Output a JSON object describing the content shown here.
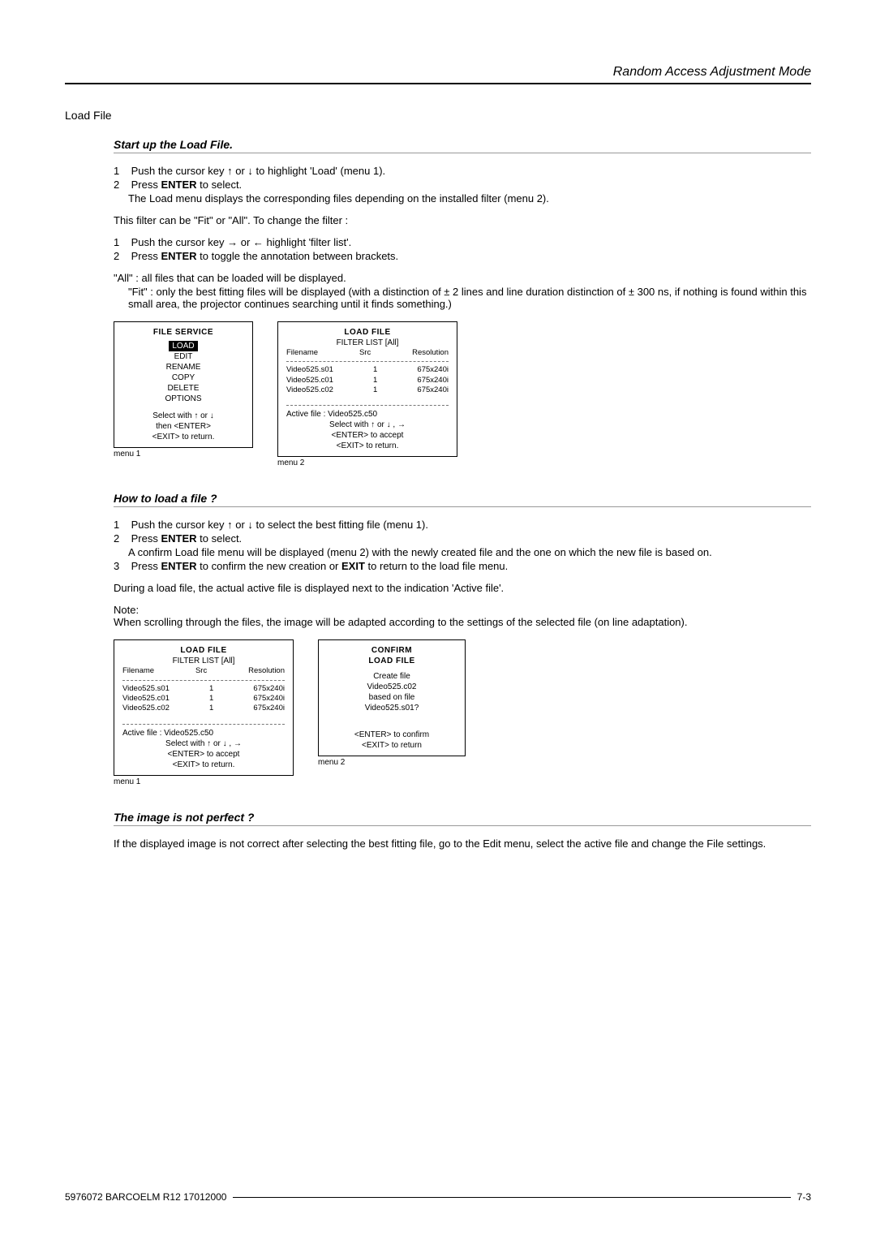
{
  "header": {
    "title": "Random Access Adjustment Mode"
  },
  "sectionTitle": "Load File",
  "s1": {
    "title": "Start up the Load File.",
    "step1a": "Push the cursor key ",
    "step1b": " or ",
    "step1c": " to highlight 'Load' (menu 1).",
    "step2a": "Press ",
    "step2b": "ENTER",
    "step2c": " to select.",
    "step2d": "The Load menu displays the corresponding files depending on the installed filter (menu 2).",
    "p1": "This filter can be \"Fit\" or \"All\".  To change the filter :",
    "f1a": "Push the cursor key ",
    "f1b": " or ",
    "f1c": " highlight 'filter list'.",
    "f2a": "Press ",
    "f2b": "ENTER",
    "f2c": " to toggle the annotation between brackets.",
    "all": "\"All\" : all files that can be loaded will be displayed.",
    "fit": "\"Fit\" : only the best fitting files will  be displayed (with a distinction of ± 2 lines and line duration distinction of ± 300 ns, if nothing is found within this small area, the projector continues searching until it finds something.)"
  },
  "fileServiceMenu": {
    "title": "FILE  SERVICE",
    "items": [
      "LOAD",
      "EDIT",
      "RENAME",
      "COPY",
      "DELETE",
      "OPTIONS"
    ],
    "hint1": "Select with ↑ or ↓",
    "hint2": "then  <ENTER>",
    "hint3": "<EXIT>  to  return.",
    "caption": "menu 1"
  },
  "loadFileMenu": {
    "title": "LOAD  FILE",
    "subtitle": "FILTER  LIST  [All]",
    "cols": [
      "Filename",
      "Src",
      "Resolution"
    ],
    "rows": [
      [
        "Video525.s01",
        "1",
        "675x240i"
      ],
      [
        "Video525.c01",
        "1",
        "675x240i"
      ],
      [
        "Video525.c02",
        "1",
        "675x240i"
      ]
    ],
    "active": "Active  file  :  Video525.c50",
    "hint1": "Select with ↑  or ↓ , →",
    "hint2": "<ENTER>  to  accept",
    "hint3": "<EXIT>  to  return.",
    "caption": "menu 2"
  },
  "s2": {
    "title": "How to load a file ?",
    "step1a": "Push the cursor key ",
    "step1b": " or ",
    "step1c": " to select the best fitting file (menu 1).",
    "step2a": "Press ",
    "step2b": "ENTER",
    "step2c": " to select.",
    "step2d": "A confirm Load file menu will be displayed (menu 2) with the newly created file and the one on which the new file is based on.",
    "step3a": "Press ",
    "step3b": "ENTER",
    "step3c": " to confirm the new creation or ",
    "step3d": "EXIT",
    "step3e": " to return to the load file menu.",
    "p1": "During a load file, the actual active file is displayed next to the indication 'Active file'.",
    "noteTitle": "Note:",
    "note": "When scrolling through the files, the image will be adapted according to the settings of the selected file (on line adaptation)."
  },
  "loadFileMenu2": {
    "caption": "menu 1"
  },
  "confirmMenu": {
    "title1": "CONFIRM",
    "title2": "LOAD  FILE",
    "l1": "Create  file",
    "l2": "Video525.c02",
    "l3": "based  on  file",
    "l4": "Video525.s01?",
    "hint1": "<ENTER>  to  confirm",
    "hint2": "<EXIT>  to  return",
    "caption": "menu 2"
  },
  "s3": {
    "title": "The image is not perfect ?",
    "p1": "If the displayed image is not correct after selecting the best fitting file, go to the Edit menu, select the active file and change the File settings."
  },
  "footer": {
    "left": "5976072  BARCOELM  R12  17012000",
    "right": "7-3"
  },
  "glyph": {
    "up": "↑",
    "down": "↓",
    "left": "←",
    "right": "→"
  }
}
